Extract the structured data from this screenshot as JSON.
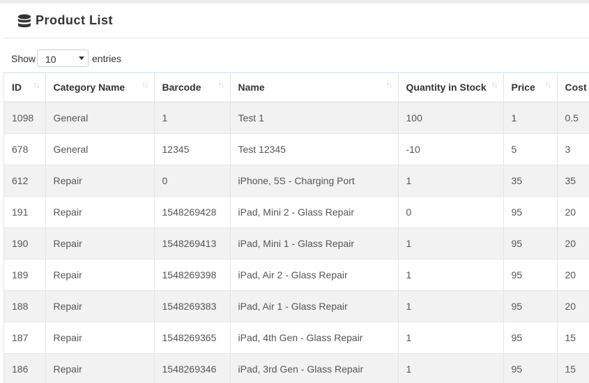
{
  "header": {
    "title": "Product List",
    "icon": "database-icon"
  },
  "length_control": {
    "show_label": "Show",
    "selected": "10",
    "entries_label": "entries"
  },
  "table": {
    "columns": [
      "ID",
      "Category Name",
      "Barcode",
      "Name",
      "Quantity in Stock",
      "Price",
      "Cost"
    ],
    "rows": [
      [
        "1098",
        "General",
        "1",
        "Test 1",
        "100",
        "1",
        "0.5"
      ],
      [
        "678",
        "General",
        "12345",
        "Test 12345",
        "-10",
        "5",
        "3"
      ],
      [
        "612",
        "Repair",
        "0",
        "iPhone, 5S - Charging Port",
        "1",
        "35",
        "35"
      ],
      [
        "191",
        "Repair",
        "1548269428",
        "iPad, Mini 2 - Glass Repair",
        "0",
        "95",
        "20"
      ],
      [
        "190",
        "Repair",
        "1548269413",
        "iPad, Mini 1 - Glass Repair",
        "1",
        "95",
        "20"
      ],
      [
        "189",
        "Repair",
        "1548269398",
        "iPad, Air 2 - Glass Repair",
        "1",
        "95",
        "20"
      ],
      [
        "188",
        "Repair",
        "1548269383",
        "iPad, Air 1 - Glass Repair",
        "1",
        "95",
        "20"
      ],
      [
        "187",
        "Repair",
        "1548269365",
        "iPad, 4th Gen - Glass Repair",
        "1",
        "95",
        "15"
      ],
      [
        "186",
        "Repair",
        "1548269346",
        "iPad, 3rd Gen - Glass Repair",
        "1",
        "95",
        "15"
      ]
    ]
  }
}
